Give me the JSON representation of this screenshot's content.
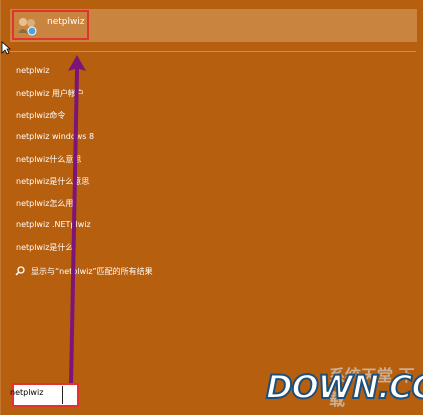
{
  "top_result": {
    "label": "netplwiz",
    "icon": "program-icon"
  },
  "suggestions": [
    "netplwiz",
    "netplwiz 用户帐户",
    "netplwiz命令",
    "netplwiz windows 8",
    "netplwiz什么意思",
    "netplwiz是什么意思",
    "netplwiz怎么用",
    "netplwiz .NETplwiz",
    "netplwiz是什么"
  ],
  "search_all": {
    "label": "显示与“netplwiz”匹配的所有结果",
    "icon": "search-icon"
  },
  "search_box": {
    "value": "netplwiz"
  },
  "watermark": {
    "brand": "DOWN.CC",
    "overlay_cn": "系统天堂 下载"
  },
  "colors": {
    "background": "#b6600f",
    "highlight": "#e2342f",
    "arrow": "#7d1479",
    "top_result_bg": "#c9843f"
  }
}
